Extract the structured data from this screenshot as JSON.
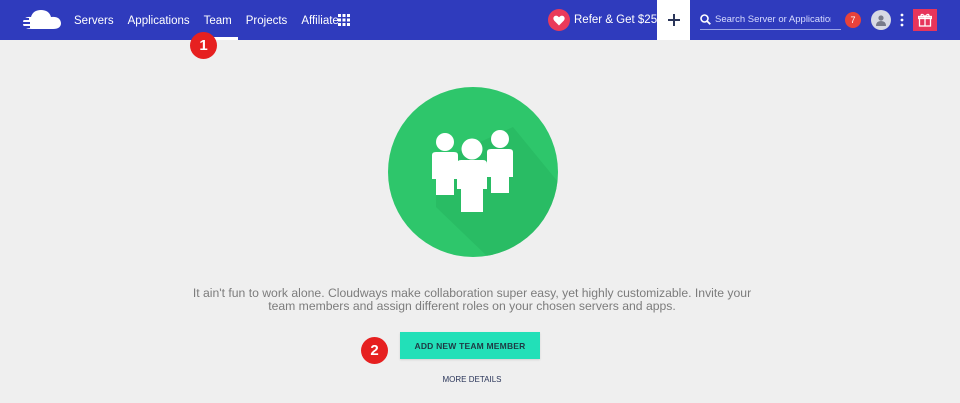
{
  "nav": {
    "items": [
      {
        "label": "Servers"
      },
      {
        "label": "Applications"
      },
      {
        "label": "Team"
      },
      {
        "label": "Projects"
      },
      {
        "label": "Affiliate"
      }
    ],
    "active": "Team",
    "icons": {
      "logo": "cloud-logo-icon",
      "apps": "grid-icon"
    }
  },
  "header": {
    "refer_label": "Refer & Get $25",
    "search_placeholder": "Search Server or Application",
    "notification_count": "7",
    "icons": [
      "heart-icon",
      "plus-icon",
      "search-icon",
      "user-icon",
      "kebab-icon",
      "gift-icon"
    ]
  },
  "markers": {
    "one": "1",
    "two": "2"
  },
  "main": {
    "description_line1": "It ain't fun to work alone. Cloudways make collaboration super easy, yet highly customizable. Invite your",
    "description_line2": "team members and assign different roles on your chosen servers and apps.",
    "cta_label": "ADD NEW TEAM MEMBER",
    "more_label": "MORE DETAILS",
    "hero_icon": "team-members-icon"
  },
  "colors": {
    "header": "#2f3bbd",
    "hero": "#2ec66b",
    "cta": "#22e0b8",
    "badge": "#e8423a",
    "gift": "#e7355b",
    "marker": "#e62020",
    "background": "#efefef"
  }
}
